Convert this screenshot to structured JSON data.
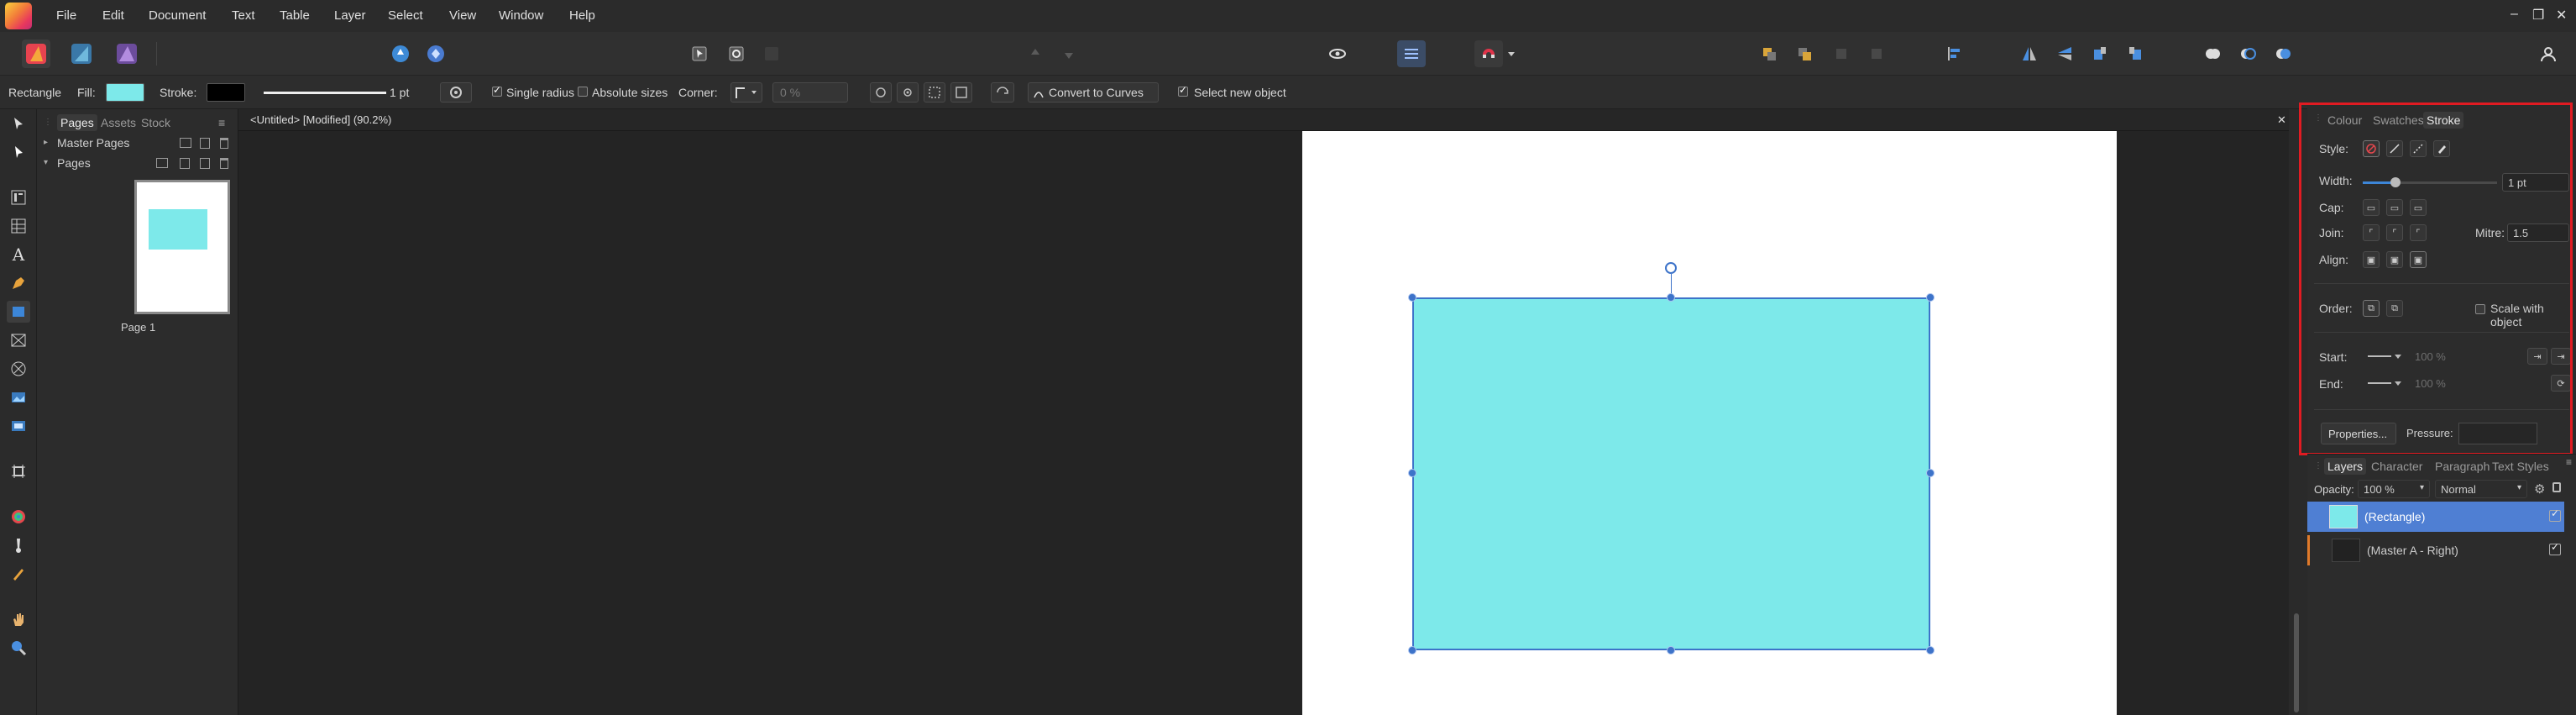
{
  "menubar": {
    "items": [
      "File",
      "Edit",
      "Document",
      "Text",
      "Table",
      "Layer",
      "Select",
      "View",
      "Window",
      "Help"
    ]
  },
  "window_controls": {
    "minimize": "–",
    "restore": "❐",
    "close": "✕"
  },
  "contextbar": {
    "tool_name": "Rectangle",
    "fill_label": "Fill:",
    "fill_color": "#7de9ea",
    "stroke_label": "Stroke:",
    "stroke_color": "#000000",
    "stroke_width": "1 pt",
    "single_radius": "Single radius",
    "absolute_sizes": "Absolute sizes",
    "corner_label": "Corner:",
    "corner_value": "0 %",
    "convert_to_curves": "Convert to Curves",
    "select_new_object": "Select new object"
  },
  "pages_panel": {
    "tabs": [
      "Pages",
      "Assets",
      "Stock"
    ],
    "master_pages": "Master Pages",
    "pages": "Pages",
    "page_caption": "Page 1"
  },
  "document": {
    "tab_title": "<Untitled> [Modified] (90.2%)",
    "close": "✕"
  },
  "stroke_panel": {
    "tabs": [
      "Colour",
      "Swatches",
      "Stroke"
    ],
    "style_label": "Style:",
    "width_label": "Width:",
    "width_value": "1 pt",
    "cap_label": "Cap:",
    "join_label": "Join:",
    "mitre_label": "Mitre:",
    "mitre_value": "1.5",
    "align_label": "Align:",
    "order_label": "Order:",
    "scale_with_object": "Scale with object",
    "start_label": "Start:",
    "end_label": "End:",
    "start_pct": "100 %",
    "end_pct": "100 %",
    "properties_button": "Properties...",
    "pressure_label": "Pressure:"
  },
  "layers_panel": {
    "tabs": [
      "Layers",
      "Character",
      "Paragraph",
      "Text Styles"
    ],
    "opacity_label": "Opacity:",
    "opacity_value": "100 %",
    "blend_mode": "Normal",
    "layers": [
      {
        "name": "(Rectangle)",
        "selected": true
      },
      {
        "name": "(Master A - Right)",
        "selected": false
      }
    ]
  }
}
